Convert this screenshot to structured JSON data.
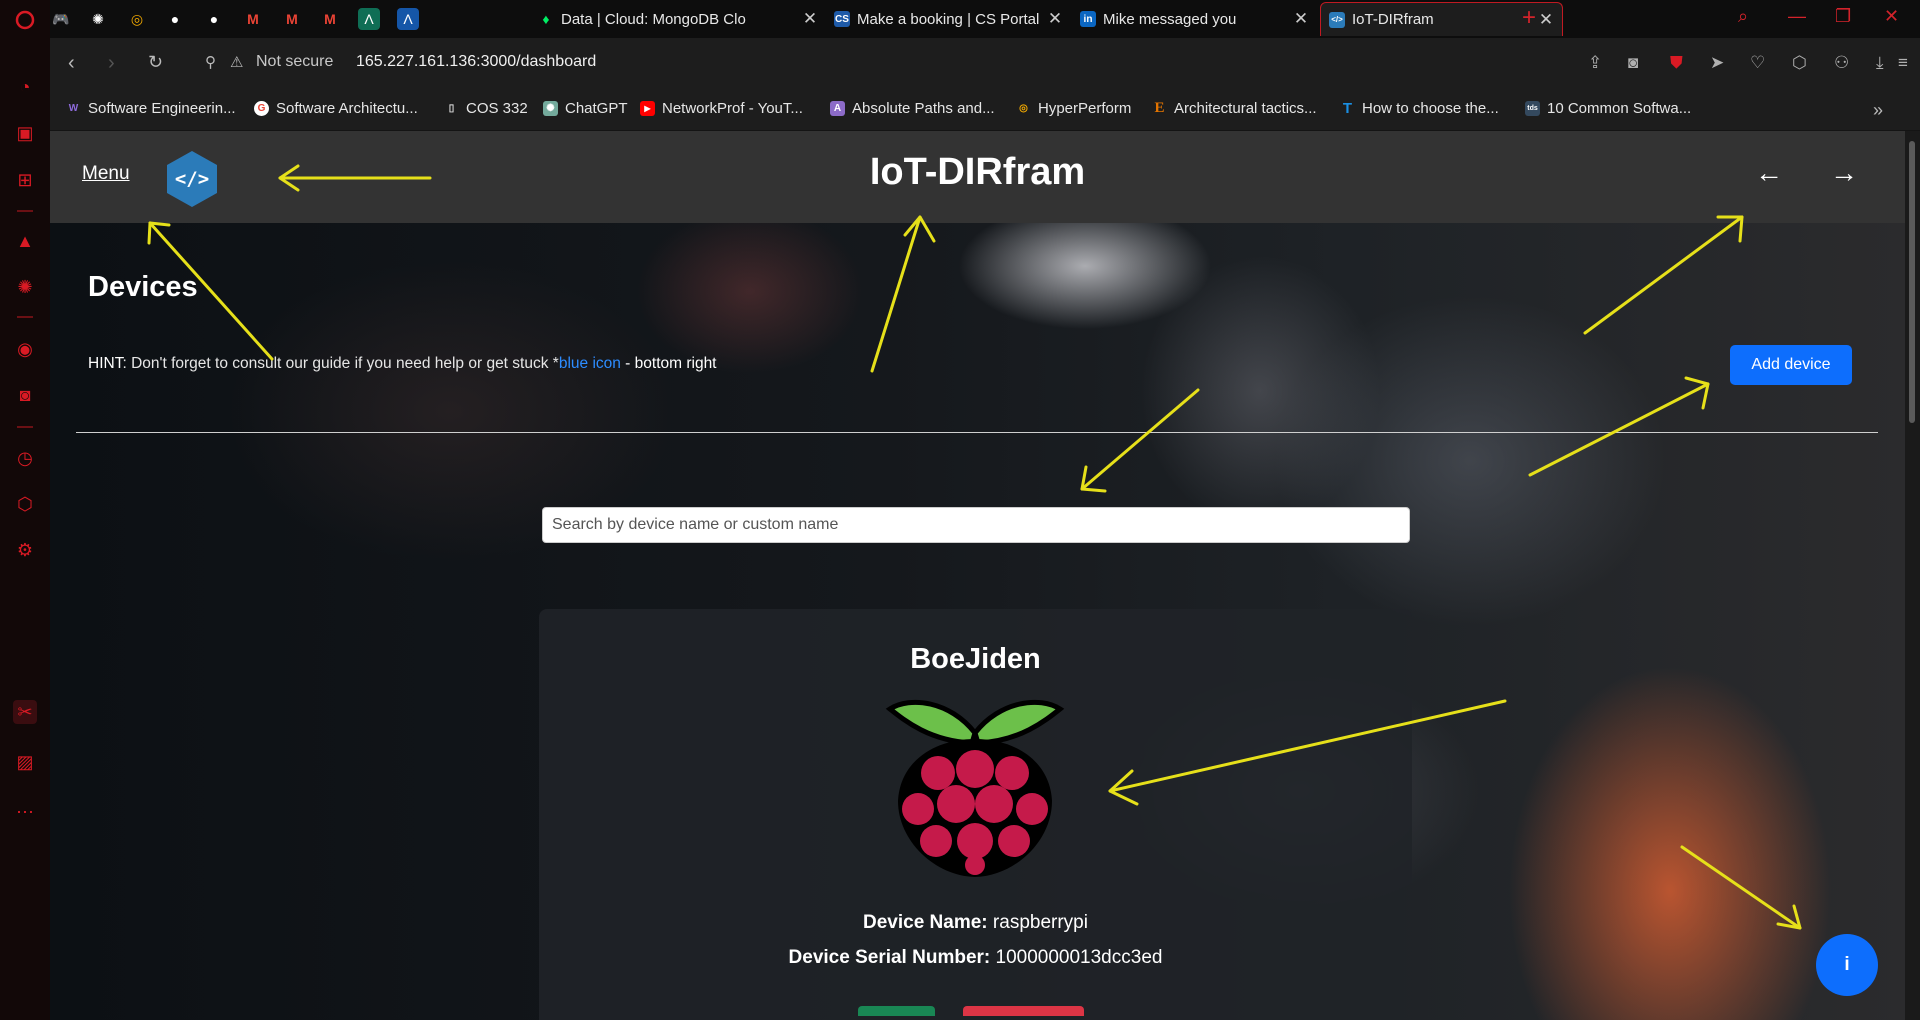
{
  "browser": {
    "tabs": [
      {
        "label": "Data | Cloud: MongoDB Clo",
        "favicon": "mongodb-leaf",
        "color": "#00ed64"
      },
      {
        "label": "Make a booking | CS Portal",
        "favicon": "CS",
        "color": "#1e5aa8"
      },
      {
        "label": "Mike messaged you",
        "favicon": "in",
        "color": "#0a66c2"
      },
      {
        "label": "IoT-DIRfram",
        "favicon": "</>",
        "color": "#2b7bb9",
        "active": true
      }
    ],
    "address": {
      "security": "Not secure",
      "url": "165.227.161.136:3000/dashboard"
    },
    "bookmarks": [
      {
        "label": "Software Engineerin...",
        "icon": "W",
        "color": "#5b3fa0"
      },
      {
        "label": "Software Architectu...",
        "icon": "G",
        "color": "#ea4335"
      },
      {
        "label": "COS 332",
        "icon": "doc",
        "color": "#e0e0e0"
      },
      {
        "label": "ChatGPT",
        "icon": "gpt",
        "color": "#74aa9c"
      },
      {
        "label": "NetworkProf - YouT...",
        "icon": "yt",
        "color": "#ff0000"
      },
      {
        "label": "Absolute Paths and...",
        "icon": "A",
        "color": "#8c6bc8"
      },
      {
        "label": "HyperPerform",
        "icon": "hp",
        "color": "#f2a900"
      },
      {
        "label": "Architectural tactics...",
        "icon": "E",
        "color": "#e37400"
      },
      {
        "label": "How to choose the...",
        "icon": "T",
        "color": "#1a8fe3"
      },
      {
        "label": "10 Common Softwa...",
        "icon": "tds",
        "color": "#34495e"
      }
    ]
  },
  "app": {
    "menu_label": "Menu",
    "brand": "IoT-DIRfram",
    "back_arrow": "←",
    "forward_arrow": "→",
    "page_title": "Devices",
    "hint": {
      "prefix": "HINT",
      "text": ": Don't forget to consult our guide if you need help or get stuck *",
      "link": "blue icon",
      "suffix": " - bottom right"
    },
    "add_device_label": "Add device",
    "search_placeholder": "Search by device name or custom name",
    "device": {
      "custom_name": "BoeJiden",
      "name_label": "Device Name:",
      "name_value": "raspberrypi",
      "serial_label": "Device Serial Number:",
      "serial_value": "1000000013dcc3ed"
    },
    "info_label": "i"
  },
  "colors": {
    "primary": "#0d6efd",
    "navbar": "#333333",
    "annotation": "#e6e01a",
    "browser_accent": "#d91a24"
  }
}
